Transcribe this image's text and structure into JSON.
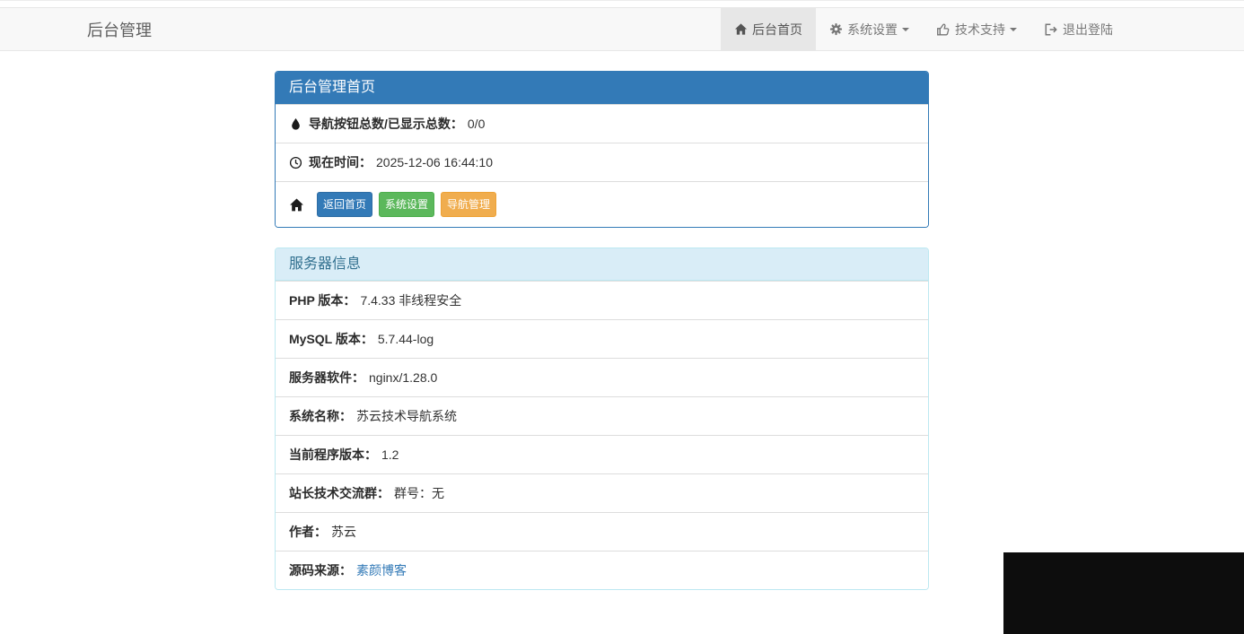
{
  "navbar": {
    "brand": "后台管理",
    "items": [
      {
        "label": "后台首页",
        "icon": "home-icon",
        "active": true,
        "caret": false
      },
      {
        "label": "系统设置",
        "icon": "gear-icon",
        "active": false,
        "caret": true
      },
      {
        "label": "技术支持",
        "icon": "thumbs-up-icon",
        "active": false,
        "caret": true
      },
      {
        "label": "退出登陆",
        "icon": "sign-out-icon",
        "active": false,
        "caret": false
      }
    ]
  },
  "dashboard_panel": {
    "title": "后台管理首页",
    "nav_stats": {
      "icon": "tint-icon",
      "label": "导航按钮总数/已显示总数：",
      "value": "0/0"
    },
    "current_time": {
      "icon": "clock-icon",
      "label": "现在时间：",
      "value": "2025-12-06 16:44:10"
    },
    "quick_links": {
      "icon": "home-icon",
      "buttons": [
        {
          "label": "返回首页",
          "color": "#337ab7"
        },
        {
          "label": "系统设置",
          "color": "#5cb85c"
        },
        {
          "label": "导航管理",
          "color": "#f0ad4e"
        }
      ]
    }
  },
  "server_panel": {
    "title": "服务器信息",
    "rows": [
      {
        "label": "PHP 版本：",
        "value": "7.4.33 非线程安全"
      },
      {
        "label": "MySQL 版本：",
        "value": "5.7.44-log"
      },
      {
        "label": "服务器软件：",
        "value": "nginx/1.28.0"
      },
      {
        "label": "系统名称：",
        "value": "苏云技术导航系统"
      },
      {
        "label": "当前程序版本：",
        "value": "1.2"
      },
      {
        "label": "站长技术交流群：",
        "value": "群号：无"
      },
      {
        "label": "作者：",
        "value": "苏云"
      },
      {
        "label": "源码来源：",
        "value": "素颜博客",
        "link": true
      }
    ]
  },
  "colors": {
    "navbar_bg": "#f8f8f8",
    "navbar_border": "#e7e7e7",
    "nav_active_bg": "#e7e7e7",
    "primary": "#337ab7",
    "success": "#5cb85c",
    "warning": "#f0ad4e",
    "info_heading_bg": "#d9edf7",
    "info_heading_text": "#31708f",
    "info_border": "#bce8f1",
    "row_border": "#dddddd",
    "link": "#337ab7",
    "void_region": "#0d0d0d"
  }
}
